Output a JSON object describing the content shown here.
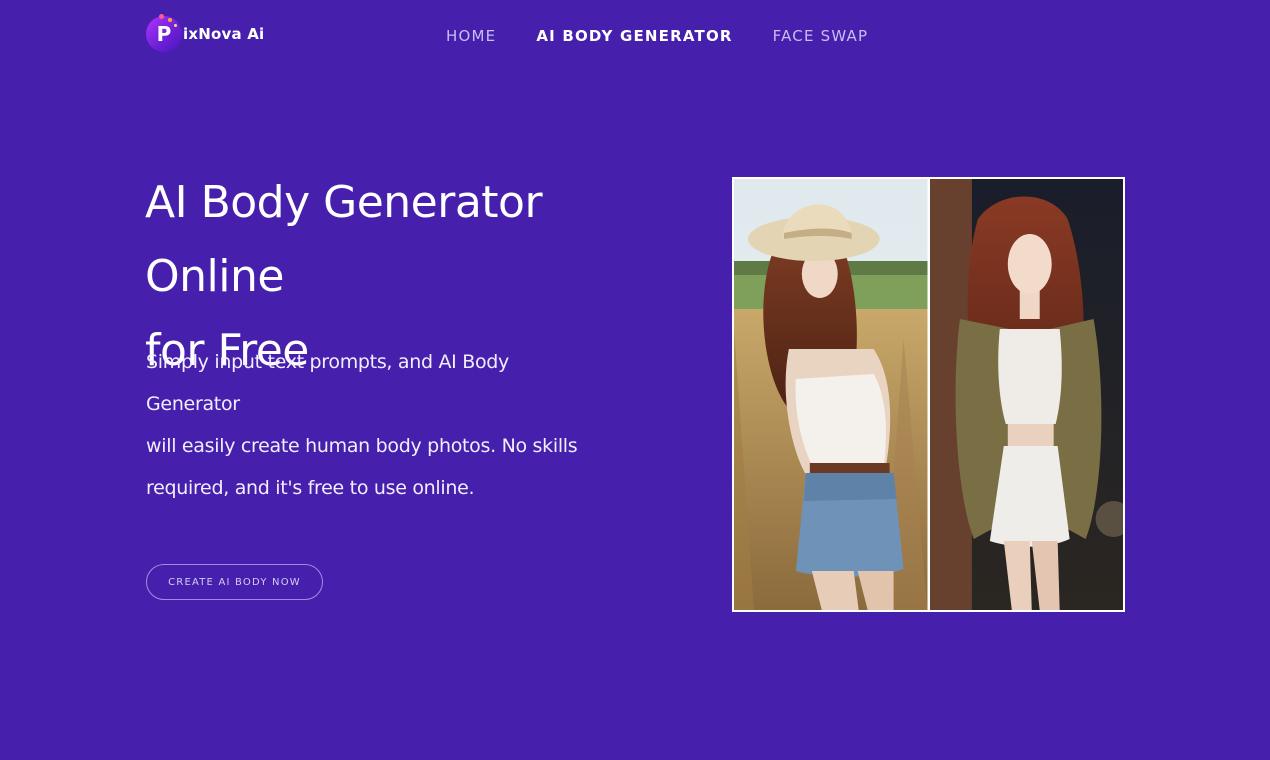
{
  "header": {
    "logo_text": "ixNova Ai",
    "logo_mark": "P",
    "nav": [
      {
        "label": "HOME",
        "active": false
      },
      {
        "label": "AI BODY GENERATOR",
        "active": true
      },
      {
        "label": "FACE SWAP",
        "active": false
      }
    ]
  },
  "hero": {
    "title_line1": "AI Body Generator Online",
    "title_line2": "for Free",
    "description_line1": "Simply input text prompts, and AI Body Generator",
    "description_line2": "will easily create human body photos. No skills",
    "description_line3": "required, and it's free to use online.",
    "cta_label": "CREATE AI BODY NOW"
  },
  "colors": {
    "background": "#4620ad",
    "text": "#ffffff",
    "nav_inactive": "#c9bdf0",
    "cta_border": "#9f8ce0"
  }
}
